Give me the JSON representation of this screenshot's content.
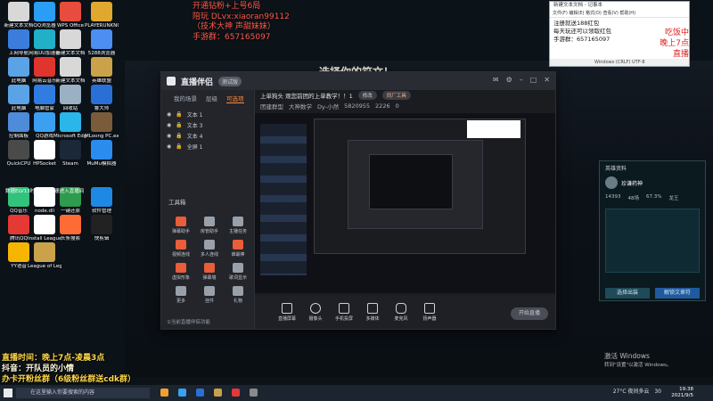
{
  "overlay_top": {
    "line1": "开通钻粉+上号6局",
    "line2": "陪玩 DLvx:xiaoran99112",
    "line3": "（技术大神 声甜妹妹）",
    "line4": "手游群：657165097"
  },
  "overlay_bottom": {
    "line1": "直播时间：晚上7点-凌晨3点",
    "line2": "抖音：开队员的小情",
    "line3": "办卡开粉丝群（6级粉丝群送cdk群）"
  },
  "game_banner": "选择你的符文！",
  "notepad": {
    "title": "新建文本文档 - 记事本",
    "menu": "文件(F)  编辑(E)  格式(O)  查看(V)  帮助(H)",
    "lines": [
      "注册就送188红包",
      "每天玩还可以领取红包",
      "手游群：657165097"
    ],
    "stamp1": "吃饭中",
    "stamp2": "晚上7点直播",
    "status": "Windows (CRLF)    UTF-8"
  },
  "desktop_icons": [
    {
      "label": "新建文本文档",
      "color": "#d8d8d8"
    },
    {
      "label": "QQ浏览器",
      "color": "#2a9df4"
    },
    {
      "label": "WPS Office",
      "color": "#e84c3d"
    },
    {
      "label": "PLAYERUNKNOWN'S BATTLEGROUNDS",
      "color": "#e0a82e"
    },
    {
      "label": "上网导航",
      "color": "#3b7ddd"
    },
    {
      "label": "网易UU加速器",
      "color": "#20b0c8"
    },
    {
      "label": "新建文本文档",
      "color": "#d8d8d8"
    },
    {
      "label": "5288浏览器",
      "color": "#4c8ef2"
    },
    {
      "label": "此电脑",
      "color": "#5aa3e6"
    },
    {
      "label": "网易云音乐",
      "color": "#e0342e"
    },
    {
      "label": "新建文本文档",
      "color": "#d8d8d8"
    },
    {
      "label": "英雄联盟",
      "color": "#c9a24a"
    },
    {
      "label": "此电脑",
      "color": "#5aa3e6"
    },
    {
      "label": "电脑管家",
      "color": "#2f7de1"
    },
    {
      "label": "回收站",
      "color": "#9cb0c4"
    },
    {
      "label": "鲁大师",
      "color": "#2a6fd6"
    },
    {
      "label": "控制面板",
      "color": "#4e8bd8"
    },
    {
      "label": "QQ游戏",
      "color": "#3ba0f0"
    },
    {
      "label": "Microsoft Edge",
      "color": "#2ab6e8"
    },
    {
      "label": "MLoong PC.exe",
      "color": "#7a5c3a"
    },
    {
      "label": "QuickCPU",
      "color": "#4a4a4a"
    },
    {
      "label": "HPSocket",
      "color": "#ffffff"
    },
    {
      "label": "Steam",
      "color": "#1b2838"
    },
    {
      "label": "MuMu模拟器",
      "color": "#2b8cf0"
    },
    {
      "label": "QQ音乐",
      "color": "#31c27c"
    },
    {
      "label": "node.dll",
      "color": "#ffffff"
    },
    {
      "label": "一键还原",
      "color": "#2e9b4f"
    },
    {
      "label": "软件管理",
      "color": "#1e88e5"
    },
    {
      "label": "腾讯QQ",
      "color": "#e53935"
    },
    {
      "label": "Install League",
      "color": "#ffffff"
    },
    {
      "label": "头条搜索",
      "color": "#ff6b35"
    },
    {
      "label": "快剪辑",
      "color": "#222222"
    },
    {
      "label": "YY语音",
      "color": "#f7b500"
    },
    {
      "label": "League of Legends",
      "color": "#c9a24a"
    }
  ],
  "desktop_caption": "数据ELV13时间段了快速进入直播间",
  "app": {
    "logo": "直播伴侣",
    "version": "测试版",
    "tabs": [
      "我的场景",
      "层级",
      "可选项"
    ],
    "scenes": [
      "文本 1",
      "文本 3",
      "文本 4",
      "全屏 1"
    ],
    "tools_title": "工具箱",
    "tools": [
      "弹幕助手",
      "房管助手",
      "主播任务",
      "视频连线",
      "多人连线",
      "谁最棒",
      "虚拟形象",
      "弹幕墙",
      "歌词显示",
      "更多",
      "挂件",
      "礼物"
    ],
    "tip": "①当前直播伴侣功能",
    "infobar_text": "上单狗头  观您前团的上单教学！！1",
    "pill_edit": "修改",
    "pill_bag": "同厂工具",
    "info_row2": [
      "团建群型",
      "大神数学",
      "Dy-小然",
      "5820955",
      "2226",
      "0"
    ],
    "bottom_tools": [
      "直播屏幕",
      "摄像头",
      "手机投屏",
      "多媒体",
      "麦克风",
      "扬声器"
    ],
    "start_live": "开始直播"
  },
  "lol_panel": {
    "title": "英雄资料",
    "hero": "珍谦药神",
    "stats": [
      "14393",
      "48场",
      "67.3%",
      "龙王"
    ],
    "buttons": [
      "选择出装",
      "解锁文章符"
    ]
  },
  "activate": {
    "line1": "激活 Windows",
    "line2": "转到\"设置\"以激活 Windows。"
  },
  "taskbar": {
    "search_placeholder": "在这里输入你要搜索的内容",
    "weather": "27°C 夜间多云",
    "tray_num": "30",
    "time": "19:38",
    "date": "2021/9/5"
  }
}
